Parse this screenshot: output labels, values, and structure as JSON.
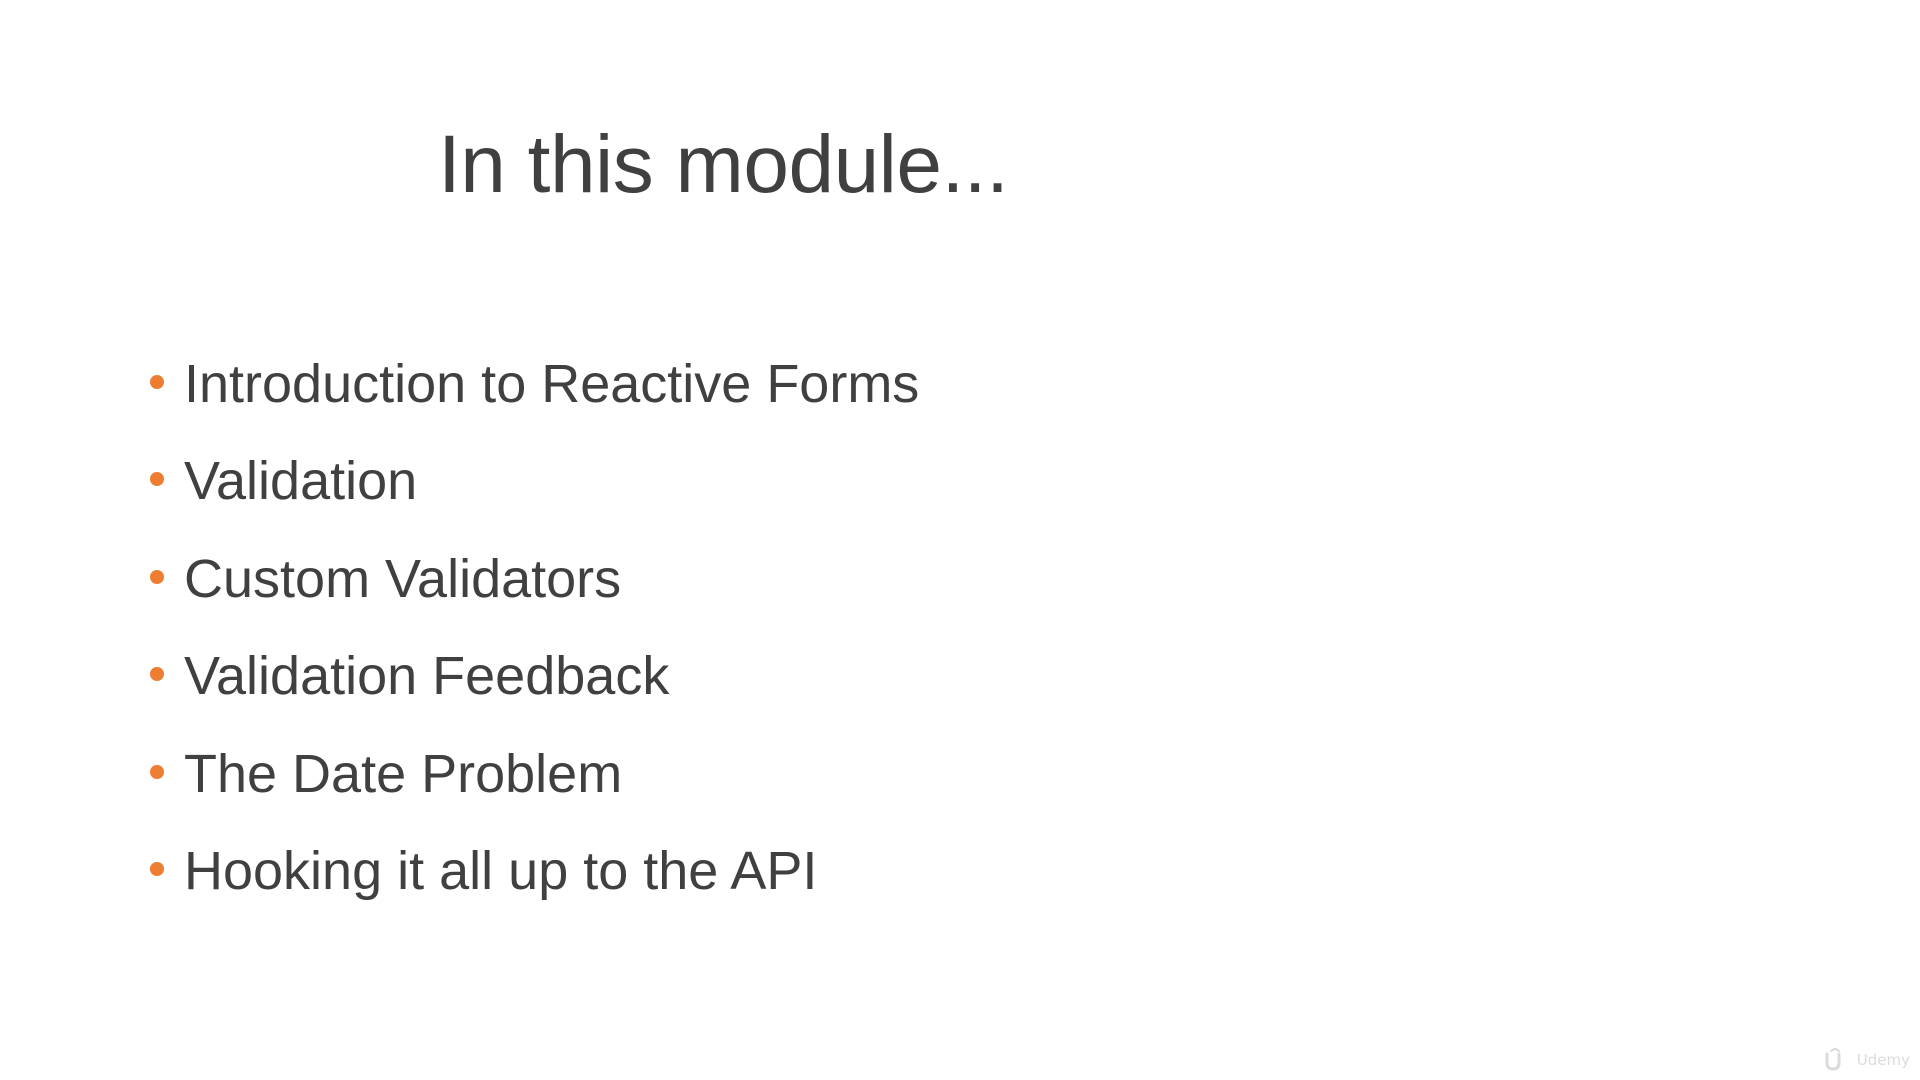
{
  "slide": {
    "title": "In this module...",
    "bullets": [
      "Introduction to Reactive Forms",
      "Validation",
      "Custom Validators",
      "Validation Feedback",
      "The Date Problem",
      "Hooking it all up to the API"
    ],
    "bullet_icon": "circle-bullet-icon",
    "bullet_color": "#ED7D31",
    "text_color": "#404040",
    "background_color": "#FFFFFF"
  },
  "watermark": {
    "icon": "udemy-logo-icon",
    "text": "Udemy"
  }
}
